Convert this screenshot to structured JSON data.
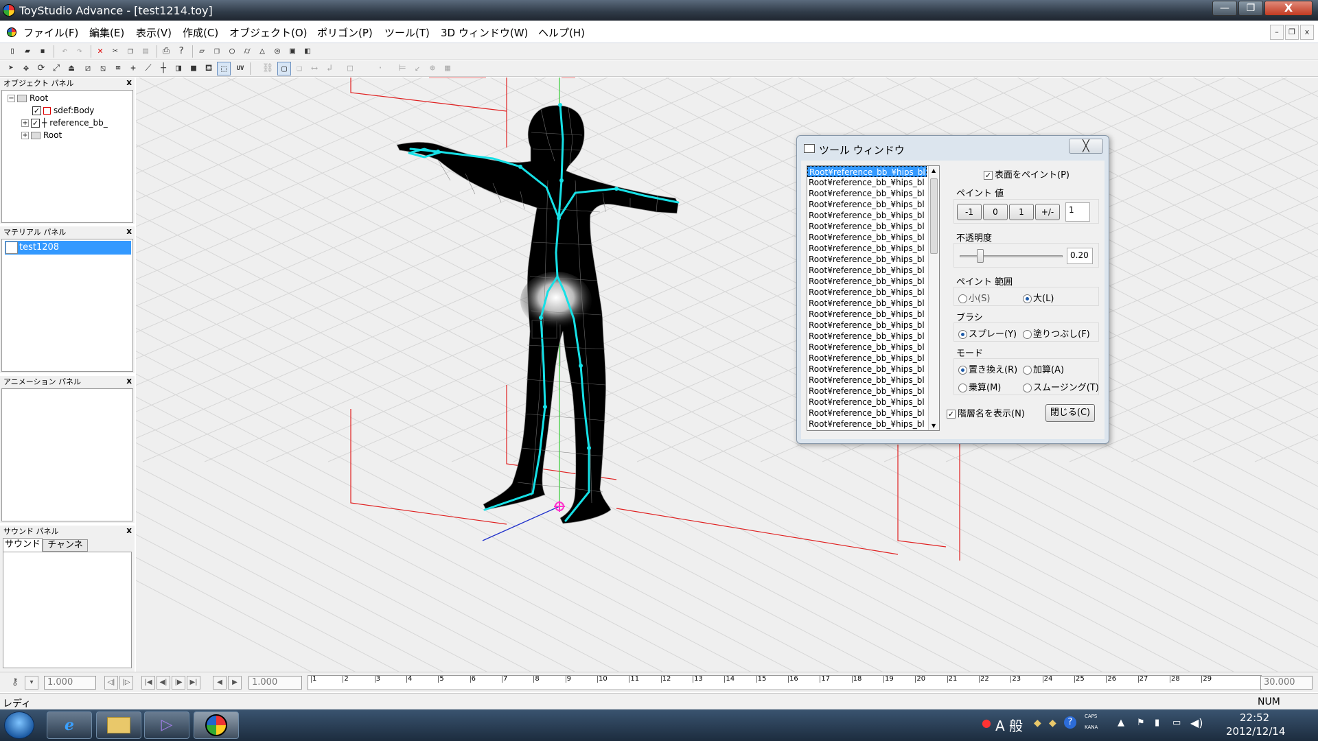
{
  "window": {
    "title": "ToyStudio Advance - [test1214.toy]",
    "btn_min": "—",
    "btn_max": "❐",
    "btn_close": "X"
  },
  "menu": [
    "ファイル(F)",
    "編集(E)",
    "表示(V)",
    "作成(C)",
    "オブジェクト(O)",
    "ポリゴン(P)",
    "ツール(T)",
    "3D ウィンドウ(W)",
    "ヘルプ(H)"
  ],
  "mdi": {
    "min": "–",
    "restore": "❐",
    "close": "x"
  },
  "toolbar2": {
    "uv_label": "UV"
  },
  "object_panel": {
    "title": "オブジェクト パネル",
    "close": "x",
    "nodes": [
      {
        "expander": "−",
        "label": "Root"
      },
      {
        "label": "sdef:Body",
        "checked": "✓"
      },
      {
        "expander": "+",
        "label": "reference_bb_",
        "checked": "✓"
      },
      {
        "expander": "+",
        "label": "Root"
      }
    ]
  },
  "material_panel": {
    "title": "マテリアル パネル",
    "close": "x",
    "items": [
      "test1208"
    ]
  },
  "animation_panel": {
    "title": "アニメーション パネル",
    "close": "x"
  },
  "sound_panel": {
    "title": "サウンド パネル",
    "close": "x",
    "tabs": [
      "サウンド",
      "チャンネル"
    ]
  },
  "timeline": {
    "field1": "1.000",
    "field2": "1.000",
    "end_value": "30.000",
    "ticks": [
      "1",
      "2",
      "3",
      "4",
      "5",
      "6",
      "7",
      "8",
      "9",
      "10",
      "11",
      "12",
      "13",
      "14",
      "15",
      "16",
      "17",
      "18",
      "19",
      "20",
      "21",
      "22",
      "23",
      "24",
      "25",
      "26",
      "27",
      "28",
      "29"
    ]
  },
  "status": {
    "text": "レディ",
    "num": "NUM"
  },
  "taskbar": {
    "ime": "A 般",
    "caps": "CAPS",
    "kana": "KANA",
    "time": "22:52",
    "date": "2012/12/14"
  },
  "tool_window": {
    "title": "ツール ウィンドウ",
    "close": "╳",
    "hierarchy_items": [
      "Root¥reference_bb_¥hips_bl",
      "Root¥reference_bb_¥hips_bl",
      "Root¥reference_bb_¥hips_bl",
      "Root¥reference_bb_¥hips_bl",
      "Root¥reference_bb_¥hips_bl",
      "Root¥reference_bb_¥hips_bl",
      "Root¥reference_bb_¥hips_bl",
      "Root¥reference_bb_¥hips_bl",
      "Root¥reference_bb_¥hips_bl",
      "Root¥reference_bb_¥hips_bl",
      "Root¥reference_bb_¥hips_bl",
      "Root¥reference_bb_¥hips_bl",
      "Root¥reference_bb_¥hips_bl",
      "Root¥reference_bb_¥hips_bl",
      "Root¥reference_bb_¥hips_bl",
      "Root¥reference_bb_¥hips_bl",
      "Root¥reference_bb_¥hips_bl",
      "Root¥reference_bb_¥hips_bl",
      "Root¥reference_bb_¥hips_bl",
      "Root¥reference_bb_¥hips_bl",
      "Root¥reference_bb_¥hips_bl",
      "Root¥reference_bb_¥hips_bl",
      "Root¥reference_bb_¥hips_bl",
      "Root¥reference_bb_¥hips_bl"
    ],
    "paint_surface": "表面をペイント(P)",
    "paint_value_label": "ペイント 値",
    "paint_buttons": [
      "-1",
      "0",
      "1",
      "+/-"
    ],
    "paint_value": "1",
    "opacity_label": "不透明度",
    "opacity_value": "0.20",
    "opacity_level": 0.2,
    "range_label": "ペイント 範囲",
    "range_small": "小(S)",
    "range_large": "大(L)",
    "brush_label": "ブラシ",
    "brush_spray": "スプレー(Y)",
    "brush_fill": "塗りつぶし(F)",
    "mode_label": "モード",
    "mode_replace": "置き換え(R)",
    "mode_add": "加算(A)",
    "mode_multiply": "乗算(M)",
    "mode_smooth": "スムージング(T)",
    "show_hierarchy": "階層名を表示(N)",
    "close_button": "閉じる(C)"
  },
  "colors": {
    "accent": "#3399ff",
    "bone": "#16e0e6",
    "grid": "#d2d2d2",
    "axis_y": "#33cc33",
    "axis_x": "#2233cc",
    "guide": "#e02020"
  }
}
